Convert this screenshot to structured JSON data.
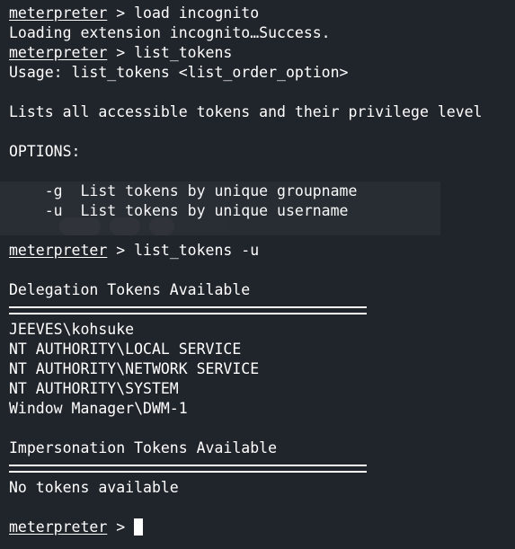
{
  "terminal": {
    "lines": {
      "l1_prompt": "meterpreter",
      "l1_cmd": " > load incognito",
      "l2": "Loading extension incognito…Success.",
      "l3_prompt": "meterpreter",
      "l3_cmd": " > list_tokens",
      "l4": "Usage: list_tokens <list_order_option>",
      "l6": "Lists all accessible tokens and their privilege level",
      "l8": "OPTIONS:",
      "l10": "    -g  List tokens by unique groupname",
      "l11": "    -u  List tokens by unique username",
      "l13_prompt": "meterpreter",
      "l13_cmd": " > list_tokens -u",
      "l15": "Delegation Tokens Available",
      "l17": "JEEVES\\kohsuke",
      "l18": "NT AUTHORITY\\LOCAL SERVICE",
      "l19": "NT AUTHORITY\\NETWORK SERVICE",
      "l20": "NT AUTHORITY\\SYSTEM",
      "l21": "Window Manager\\DWM-1",
      "l23": "Impersonation Tokens Available",
      "l25": "No tokens available",
      "l27_prompt": "meterpreter",
      "l27_cmd": " > "
    }
  },
  "colors": {
    "background": "#20242b",
    "text": "#ffffff"
  }
}
